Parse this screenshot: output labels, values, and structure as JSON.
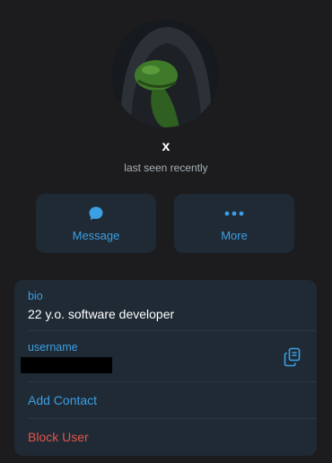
{
  "profile": {
    "name": "x",
    "status": "last seen recently"
  },
  "actions": {
    "message_label": "Message",
    "more_label": "More"
  },
  "info": {
    "bio_label": "bio",
    "bio_value": "22 y.o. software developer",
    "username_label": "username",
    "add_contact_label": "Add Contact",
    "block_user_label": "Block User"
  },
  "colors": {
    "background": "#1c1c1e",
    "card": "#1f2a35",
    "accent": "#3d9fe3",
    "danger": "#e5534b"
  },
  "icons": {
    "message": "chat-bubble-icon",
    "more": "ellipsis-icon",
    "copy": "copy-icon"
  }
}
